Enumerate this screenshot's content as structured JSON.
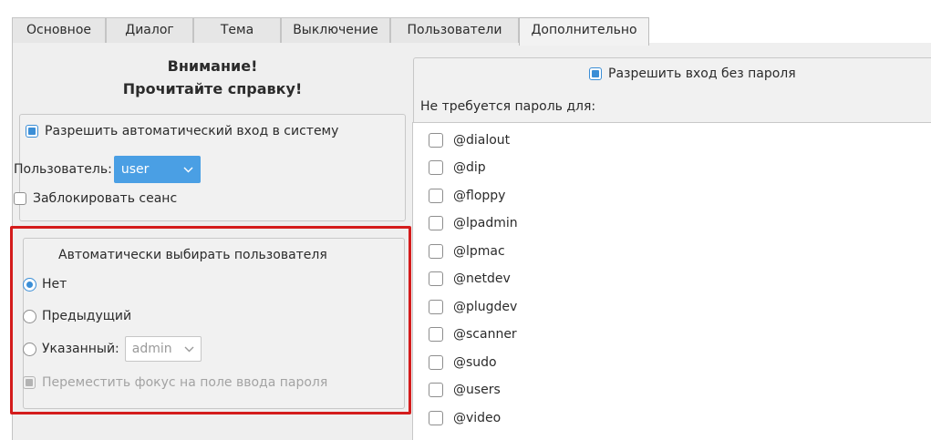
{
  "tabs": [
    {
      "label": "Основное",
      "active": false
    },
    {
      "label": "Диалог",
      "active": false
    },
    {
      "label": "Тема",
      "active": false
    },
    {
      "label": "Выключение",
      "active": false
    },
    {
      "label": "Пользователи",
      "active": false
    },
    {
      "label": "Дополнительно",
      "active": true
    }
  ],
  "left": {
    "warning_line1": "Внимание!",
    "warning_line2": "Прочитайте справку!",
    "autologin": {
      "enable_label": "Разрешить автоматический вход в систему",
      "enable_checked": true,
      "user_label": "Пользователь:",
      "user_value": "user",
      "lock_label": "Заблокировать сеанс",
      "lock_checked": false
    },
    "autoselect": {
      "title": "Автоматически выбирать пользователя",
      "option_none": "Нет",
      "option_previous": "Предыдущий",
      "option_specified": "Указанный:",
      "selected_option": "Нет",
      "specified_value": "admin",
      "focus_label": "Переместить фокус на поле ввода пароля",
      "focus_checked": true
    }
  },
  "right": {
    "passwordless_label": "Разрешить вход без пароля",
    "passwordless_checked": true,
    "not_required_label": "Не требуется пароль для:",
    "groups": [
      {
        "name": "@dialout",
        "checked": false
      },
      {
        "name": "@dip",
        "checked": false
      },
      {
        "name": "@floppy",
        "checked": false
      },
      {
        "name": "@lpadmin",
        "checked": false
      },
      {
        "name": "@lpmac",
        "checked": false
      },
      {
        "name": "@netdev",
        "checked": false
      },
      {
        "name": "@plugdev",
        "checked": false
      },
      {
        "name": "@scanner",
        "checked": false
      },
      {
        "name": "@sudo",
        "checked": false
      },
      {
        "name": "@users",
        "checked": false
      },
      {
        "name": "@video",
        "checked": false
      }
    ]
  },
  "colors": {
    "accent": "#4a9fe4",
    "highlight_border": "#d41c1c"
  }
}
